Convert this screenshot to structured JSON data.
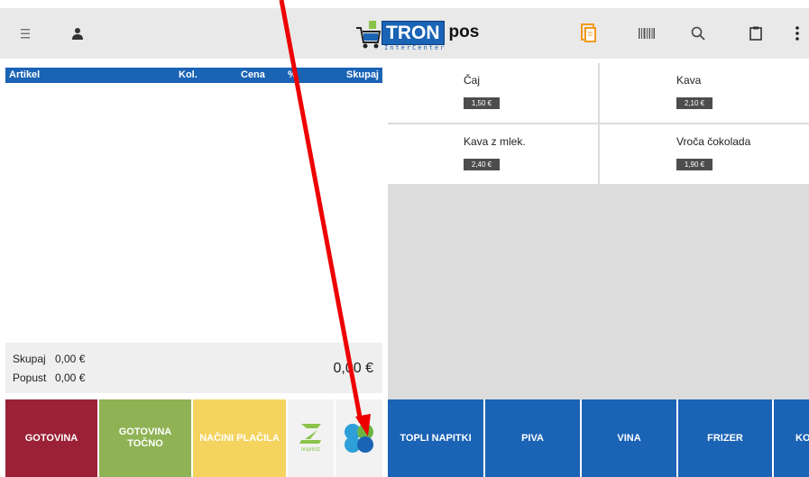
{
  "app": {
    "logo_main": "TRON",
    "logo_suffix": "pos",
    "logo_sub": "InterCenter"
  },
  "icons": [
    "menu-icon",
    "user-icon",
    "cart-icon",
    "document-icon",
    "barcode-icon",
    "search-icon",
    "clipboard-icon",
    "more-vertical-icon"
  ],
  "receipt": {
    "columns": {
      "item": "Artikel",
      "qty": "Kol.",
      "price": "Cena",
      "discount": "%",
      "total": "Skupaj"
    },
    "subtotal_label": "Skupaj",
    "subtotal_value": "0,00 €",
    "discount_label": "Popust",
    "discount_value": "0,00 €",
    "grand_total": "0,00 €"
  },
  "products": [
    {
      "name": "Čaj",
      "price": "1,50 €"
    },
    {
      "name": "Kava",
      "price": "2,10 €"
    },
    {
      "name": "Kava z mlek.",
      "price": "2,40 €"
    },
    {
      "name": "Vroča čokolada",
      "price": "1,90 €"
    }
  ],
  "payment": {
    "cash": "GOTOVINA",
    "cash_exact_line1": "GOTOVINA",
    "cash_exact_line2": "TOČNO",
    "methods": "NAČINI PLAČILA",
    "noprintz_label": "noprintz"
  },
  "categories": [
    "TOPLI NAPITKI",
    "PIVA",
    "VINA",
    "FRIZER",
    "KO"
  ],
  "colors": {
    "blue": "#1a63b5",
    "cash": "#9a2136",
    "cash_exact": "#8fb255",
    "methods": "#f4d35e",
    "annotation_arrow": "#ee0000"
  }
}
